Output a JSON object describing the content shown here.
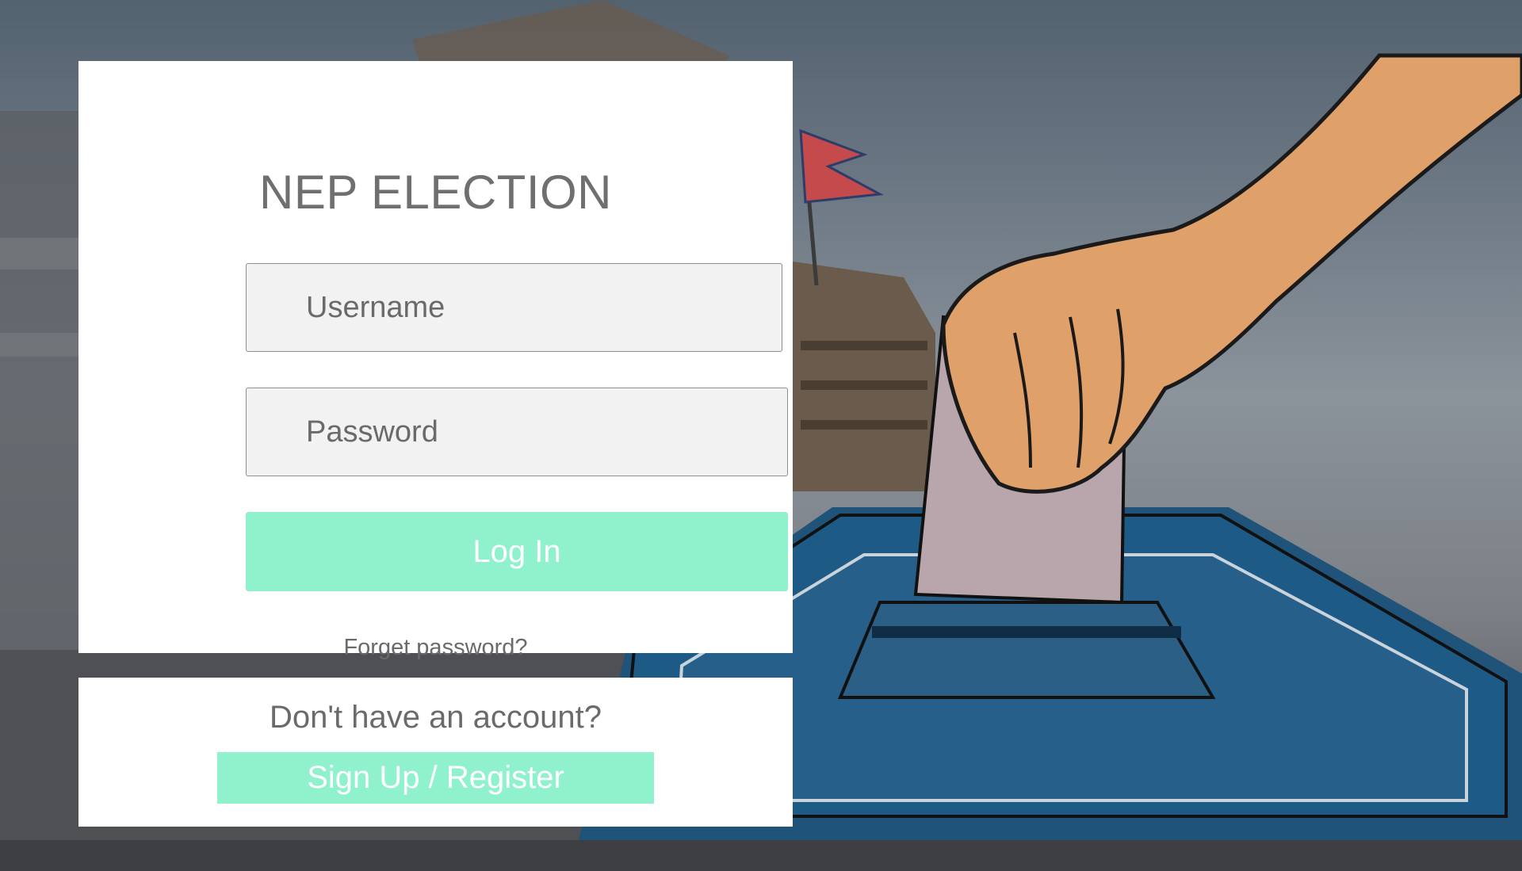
{
  "app": {
    "title": "NEP ELECTION"
  },
  "login": {
    "username_placeholder": "Username",
    "username_value": "",
    "password_placeholder": "Password",
    "password_value": "",
    "login_label": "Log In",
    "forgot_label": "Forget password?"
  },
  "signup": {
    "prompt": "Don't have an account?",
    "button_label": "Sign Up / Register"
  },
  "colors": {
    "accent": "#90f2cc",
    "text": "#6a6a6a",
    "card": "#ffffff",
    "field_bg": "#f2f2f2"
  },
  "background": {
    "icons": [
      "nepal-flag-icon",
      "ballot-box-icon",
      "hand-icon",
      "ballot-paper-icon"
    ]
  }
}
